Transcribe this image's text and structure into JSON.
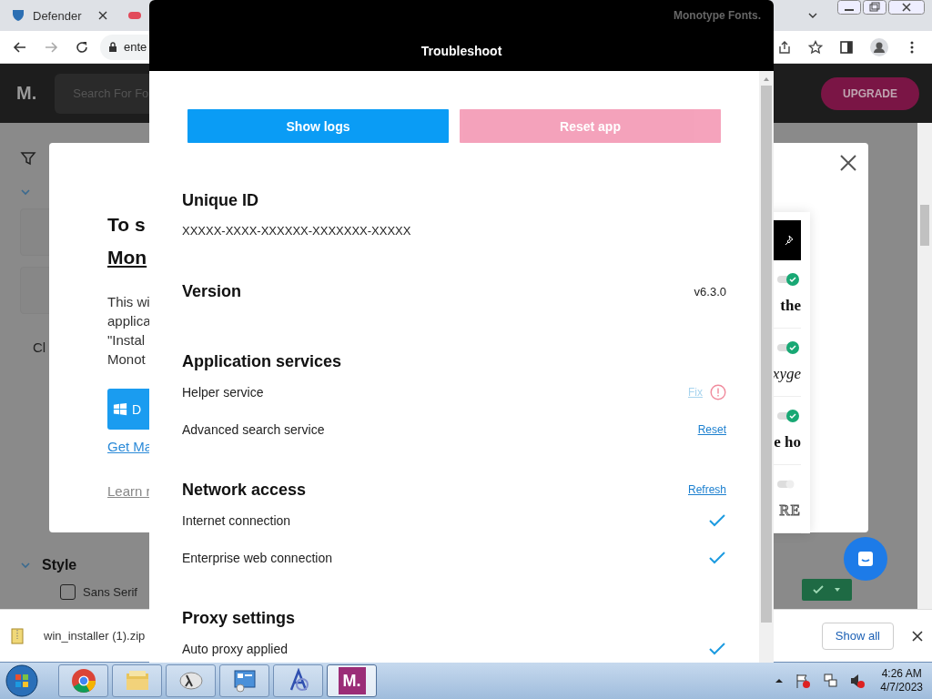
{
  "browser": {
    "tabs": [
      {
        "title": "Defender",
        "selected": false
      }
    ],
    "address": "ente"
  },
  "site": {
    "logo": "M.",
    "search_placeholder": "Search For Fo",
    "upgrade": "UPGRADE",
    "filter_item": "Cl",
    "style_section": "Style",
    "style_option": {
      "label": "Sans Serif",
      "checked": false
    }
  },
  "install_dialog": {
    "heading_line1": "To s",
    "heading_line2": "Mon",
    "body_lines": [
      "This wi",
      "applica",
      "\"Instal",
      "Monot"
    ],
    "download_button": "D",
    "link": "Get Ma",
    "learn_more": "Learn r"
  },
  "font_previews": [
    {
      "sample": "the",
      "kind": "bold",
      "checked": true
    },
    {
      "sample": "xyge",
      "kind": "script",
      "checked": true
    },
    {
      "sample": "e ho",
      "kind": "bold",
      "checked": true
    },
    {
      "sample": "RE",
      "kind": "outline",
      "checked": false
    }
  ],
  "troubleshoot": {
    "brand": "Monotype Fonts.",
    "title": "Troubleshoot",
    "buttons": [
      {
        "label": "Show logs",
        "kind": "primary",
        "disabled": false
      },
      {
        "label": "Reset app",
        "kind": "danger",
        "disabled": true
      }
    ],
    "sections": [
      {
        "kind": "id",
        "title": "Unique ID",
        "value": "XXXXX-XXXX-XXXXXX-XXXXXXX-XXXXX"
      },
      {
        "kind": "version",
        "title": "Version",
        "value": "v6.3.0"
      },
      {
        "kind": "list",
        "title": "Application services",
        "rows": [
          {
            "label": "Helper service",
            "action": "Fix",
            "kind": "warning"
          },
          {
            "label": "Advanced search service",
            "action": "Reset",
            "kind": "plain"
          }
        ]
      },
      {
        "kind": "list",
        "title": "Network access",
        "action": "Refresh",
        "rows": [
          {
            "label": "Internet connection",
            "kind": "check"
          },
          {
            "label": "Enterprise web connection",
            "kind": "check"
          }
        ]
      },
      {
        "kind": "list",
        "title": "Proxy settings",
        "rows": [
          {
            "label": "Auto proxy applied",
            "kind": "check"
          }
        ]
      }
    ]
  },
  "downloads": {
    "file": "win_installer (1).zip",
    "show_all": "Show all"
  },
  "taskbar": {
    "apps": [
      {
        "kind": "chrome",
        "selected": false
      },
      {
        "kind": "folder",
        "selected": false
      },
      {
        "kind": "lambda",
        "selected": false
      },
      {
        "kind": "panel",
        "selected": false
      },
      {
        "kind": "font",
        "selected": false
      },
      {
        "kind": "monotype",
        "label": "M.",
        "selected": true
      }
    ],
    "time": "4:26 AM",
    "date": "4/7/2023"
  }
}
